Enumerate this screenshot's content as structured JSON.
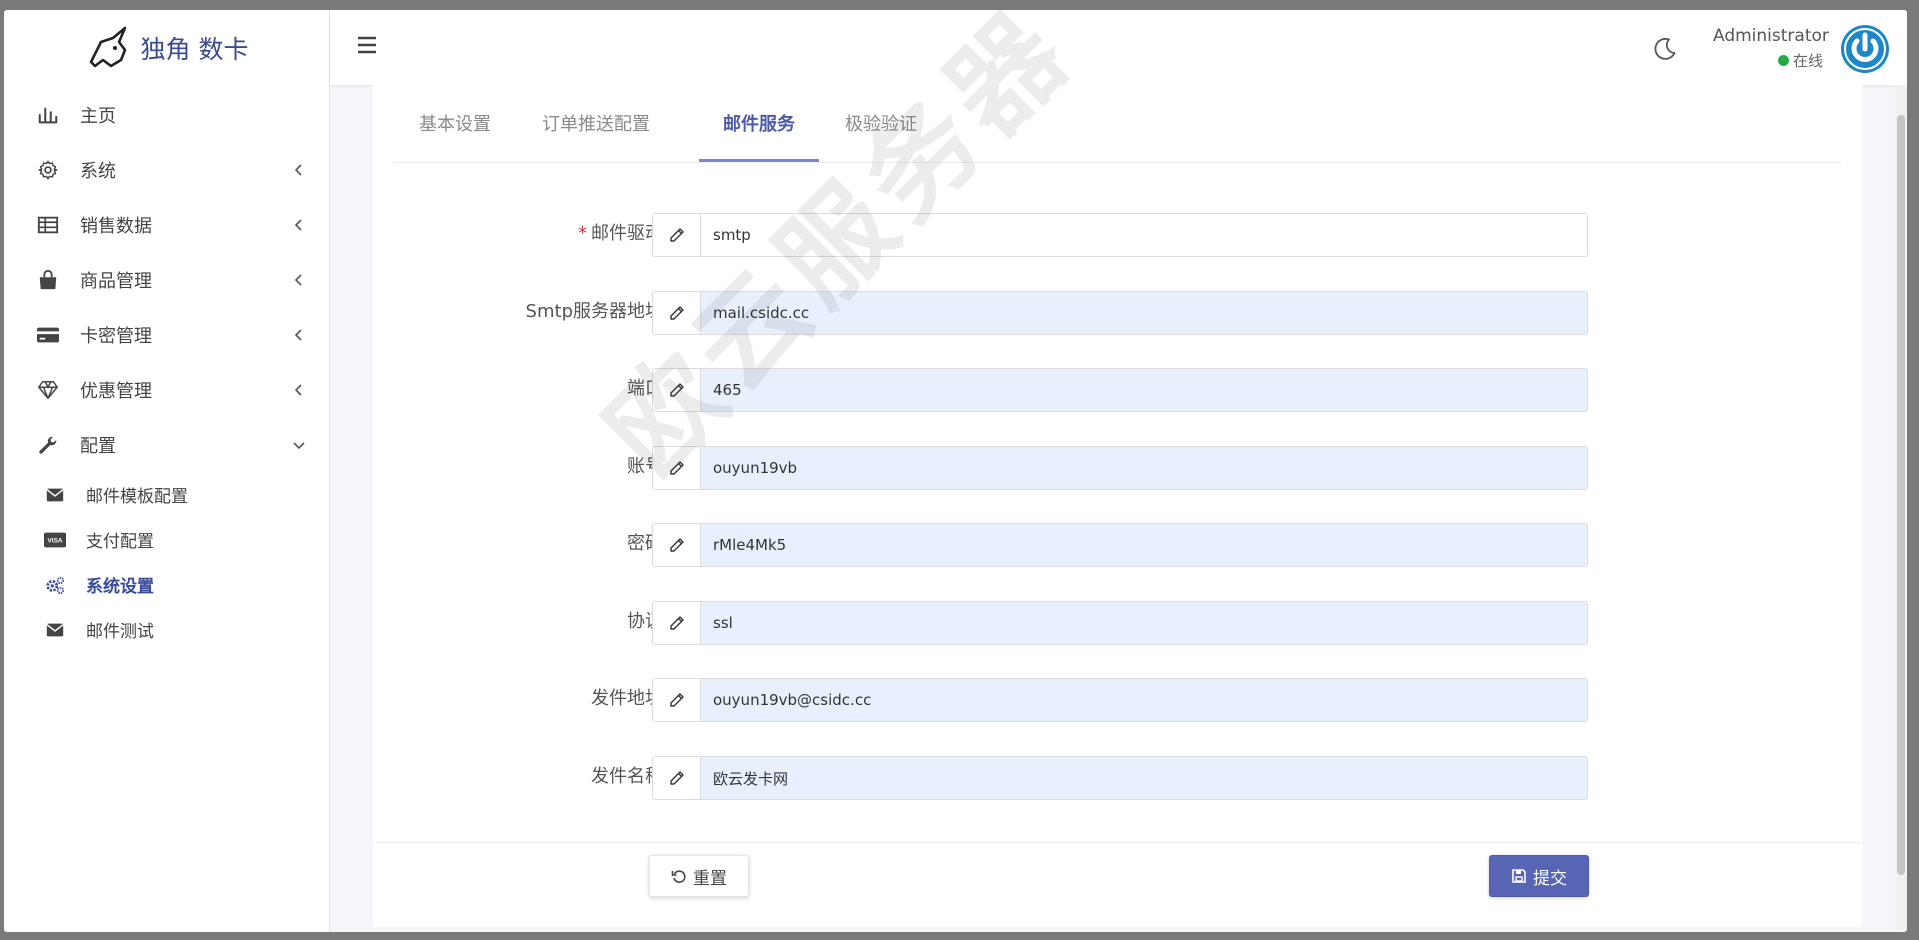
{
  "brand": {
    "name": "独角 数卡",
    "logo_icon": "unicorn-logo-icon"
  },
  "sidebar": {
    "items": [
      {
        "label": "主页",
        "icon": "bar-chart-icon"
      },
      {
        "label": "系统",
        "icon": "gear-icon"
      },
      {
        "label": "销售数据",
        "icon": "table-icon"
      },
      {
        "label": "商品管理",
        "icon": "shopping-bag-icon"
      },
      {
        "label": "卡密管理",
        "icon": "credit-card-icon"
      },
      {
        "label": "优惠管理",
        "icon": "gem-icon"
      },
      {
        "label": "配置",
        "icon": "wrench-icon"
      }
    ],
    "sub_items": [
      {
        "label": "邮件模板配置",
        "icon": "envelope-icon"
      },
      {
        "label": "支付配置",
        "icon": "visa-icon"
      },
      {
        "label": "系统设置",
        "icon": "cogs-icon"
      },
      {
        "label": "邮件测试",
        "icon": "envelope-icon"
      }
    ],
    "active_sub": "系统设置"
  },
  "header": {
    "user_name": "Administrator",
    "status": "在线",
    "status_color": "#28a745"
  },
  "tabs": [
    "基本设置",
    "订单推送配置",
    "邮件服务",
    "极验验证"
  ],
  "active_tab": "邮件服务",
  "form": {
    "fields": [
      {
        "label": "邮件驱动",
        "required": true,
        "value": "smtp"
      },
      {
        "label": "Smtp服务器地址",
        "value": "mail.csidc.cc"
      },
      {
        "label": "端口",
        "value": "465"
      },
      {
        "label": "账号",
        "value": "ouyun19vb"
      },
      {
        "label": "密码",
        "value": "rMle4Mk5"
      },
      {
        "label": "协议",
        "value": "ssl"
      },
      {
        "label": "发件地址",
        "value": "ouyun19vb@csidc.cc"
      },
      {
        "label": "发件名称",
        "value": "欧云发卡网"
      }
    ],
    "reset_label": "重置",
    "submit_label": "提交"
  },
  "watermark": "欧云服务器",
  "colors": {
    "accent": "#4d5aa6",
    "submit": "#5865b4",
    "autofill": "#e8f0fe"
  }
}
